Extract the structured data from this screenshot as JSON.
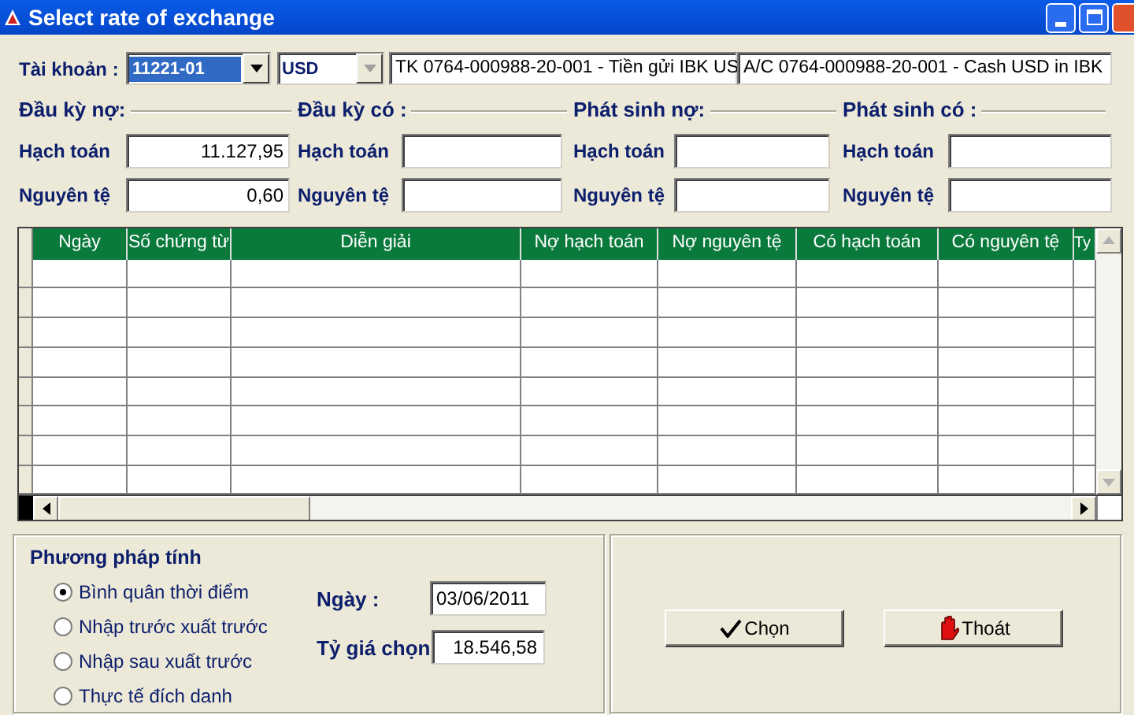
{
  "window": {
    "title": "Select rate of exchange"
  },
  "account": {
    "label": "Tài khoản :",
    "code": "11221-01",
    "currency": "USD",
    "name_vn": "TK 0764-000988-20-001 - Tiền gửi IBK US",
    "name_en": "A/C 0764-000988-20-001  - Cash USD in IBK"
  },
  "balances": [
    {
      "heading": "Đầu kỳ nợ:",
      "rows": [
        {
          "label": "Hạch toán",
          "value": "11.127,95"
        },
        {
          "label": "Nguyên tệ",
          "value": "0,60"
        }
      ]
    },
    {
      "heading": "Đầu kỳ có :",
      "rows": [
        {
          "label": "Hạch toán"
        },
        {
          "label": "Nguyên tệ"
        }
      ]
    },
    {
      "heading": "Phát sinh nợ:",
      "rows": [
        {
          "label": "Hạch toán"
        },
        {
          "label": "Nguyên tệ"
        }
      ]
    },
    {
      "heading": "Phát sinh có :",
      "rows": [
        {
          "label": "Hạch toán"
        },
        {
          "label": "Nguyên tệ"
        }
      ]
    }
  ],
  "grid": {
    "columns": [
      "Ngày",
      "Số chứng từ",
      "Diễn giải",
      "Nợ hạch toán",
      "Nợ nguyên tệ",
      "Có hạch toán",
      "Có nguyên tệ",
      "Ty"
    ]
  },
  "method": {
    "title": "Phương pháp tính",
    "options": [
      {
        "label": "Bình quân thời điểm",
        "selected": true
      },
      {
        "label": "Nhập trước xuất trước",
        "selected": false
      },
      {
        "label": "Nhập sau xuất trước",
        "selected": false
      },
      {
        "label": "Thực tế đích danh",
        "selected": false
      }
    ]
  },
  "date": {
    "label": "Ngày :",
    "value": "03/06/2011"
  },
  "rate": {
    "label": "Tỷ giá chọn",
    "value": "18.546,58"
  },
  "buttons": [
    {
      "kind": "choose",
      "label": "Chọn"
    },
    {
      "kind": "exit",
      "label": "Thoát"
    }
  ]
}
